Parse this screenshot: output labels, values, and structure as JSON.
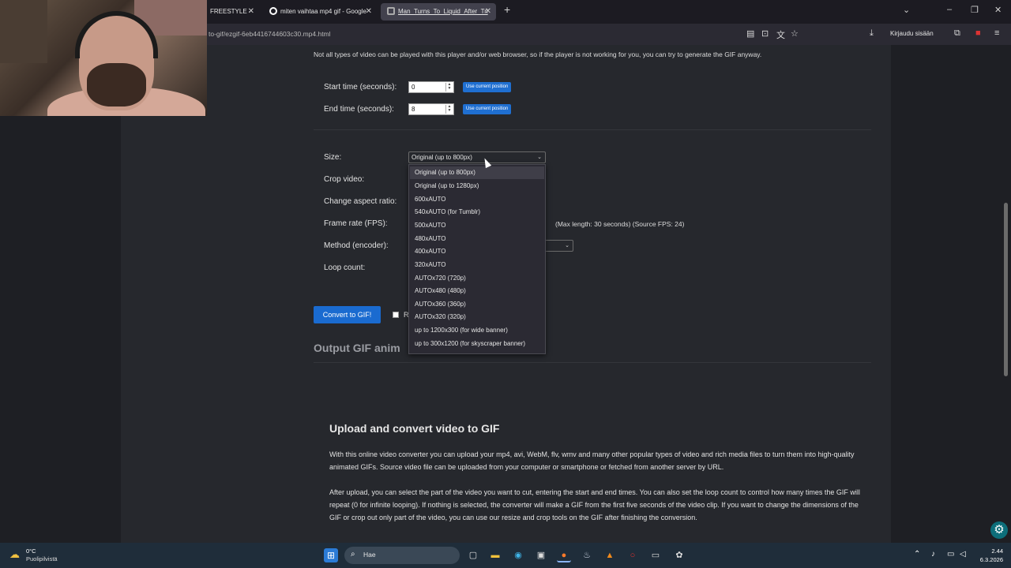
{
  "browser": {
    "tabs": [
      {
        "label": "FREESTYLE -"
      },
      {
        "label": "miten vaihtaa mp4 gif - Google"
      },
      {
        "label": "Man_Turns_To_Liquid_After_Tri"
      }
    ],
    "url": "to-gif/ezgif-6eb4416744603c30.mp4.html",
    "signin_label": "Kirjaudu sisään"
  },
  "page": {
    "notice": "Not all types of video can be played with this player and/or web browser, so if the player is not working for you, you can try to generate the GIF anyway.",
    "start_label": "Start time (seconds):",
    "start_value": "0",
    "end_label": "End time (seconds):",
    "end_value": "8",
    "use_current_label": "Use current position",
    "size_label": "Size:",
    "size_selected": "Original (up to 800px)",
    "crop_label": "Crop video:",
    "aspect_label": "Change aspect ratio:",
    "fps_label": "Frame rate (FPS):",
    "fps_note": "(Max length: 30 seconds) (Source FPS: 24)",
    "method_label": "Method (encoder):",
    "loop_label": "Loop count:",
    "convert_label": "Convert to GIF!",
    "checkbox_label_partial": "R",
    "output_heading": "Output GIF anim",
    "upload_heading": "Upload and convert video to GIF",
    "para1": "With this online video converter you can upload your mp4, avi, WebM, flv, wmv and many other popular types of video and rich media files to turn them into high-quality animated GIFs. Source video file can be uploaded from your computer or smartphone or fetched from another server by URL.",
    "para2": "After upload, you can select the part of the video you want to cut, entering the start and end times. You can also set the loop count to control how many times the GIF will repeat (0 for infinite looping). If nothing is selected, the converter will make a GIF from the first five seconds of the video clip. If you want to change the dimensions of the GIF or crop out only part of the video, you can use our resize and crop tools on the GIF after finishing the conversion."
  },
  "size_options": [
    "Original (up to 800px)",
    "Original (up to 1280px)",
    "600xAUTO",
    "540xAUTO (for Tumblr)",
    "500xAUTO",
    "480xAUTO",
    "400xAUTO",
    "320xAUTO",
    "AUTOx720 (720p)",
    "AUTOx480 (480p)",
    "AUTOx360 (360p)",
    "AUTOx320 (320p)",
    "up to 1200x300 (for wide banner)",
    "up to 300x1200 (for skyscraper banner)"
  ],
  "taskbar": {
    "weather_temp": "0°C",
    "weather_desc": "Puolipilvistä",
    "search_label": "Hae",
    "time": "2.44",
    "date": "6.3.2026"
  },
  "colors": {
    "accent_blue": "#1f6fd1",
    "page_bg": "#26282d",
    "taskbar_bg": "#1f2d3a"
  }
}
